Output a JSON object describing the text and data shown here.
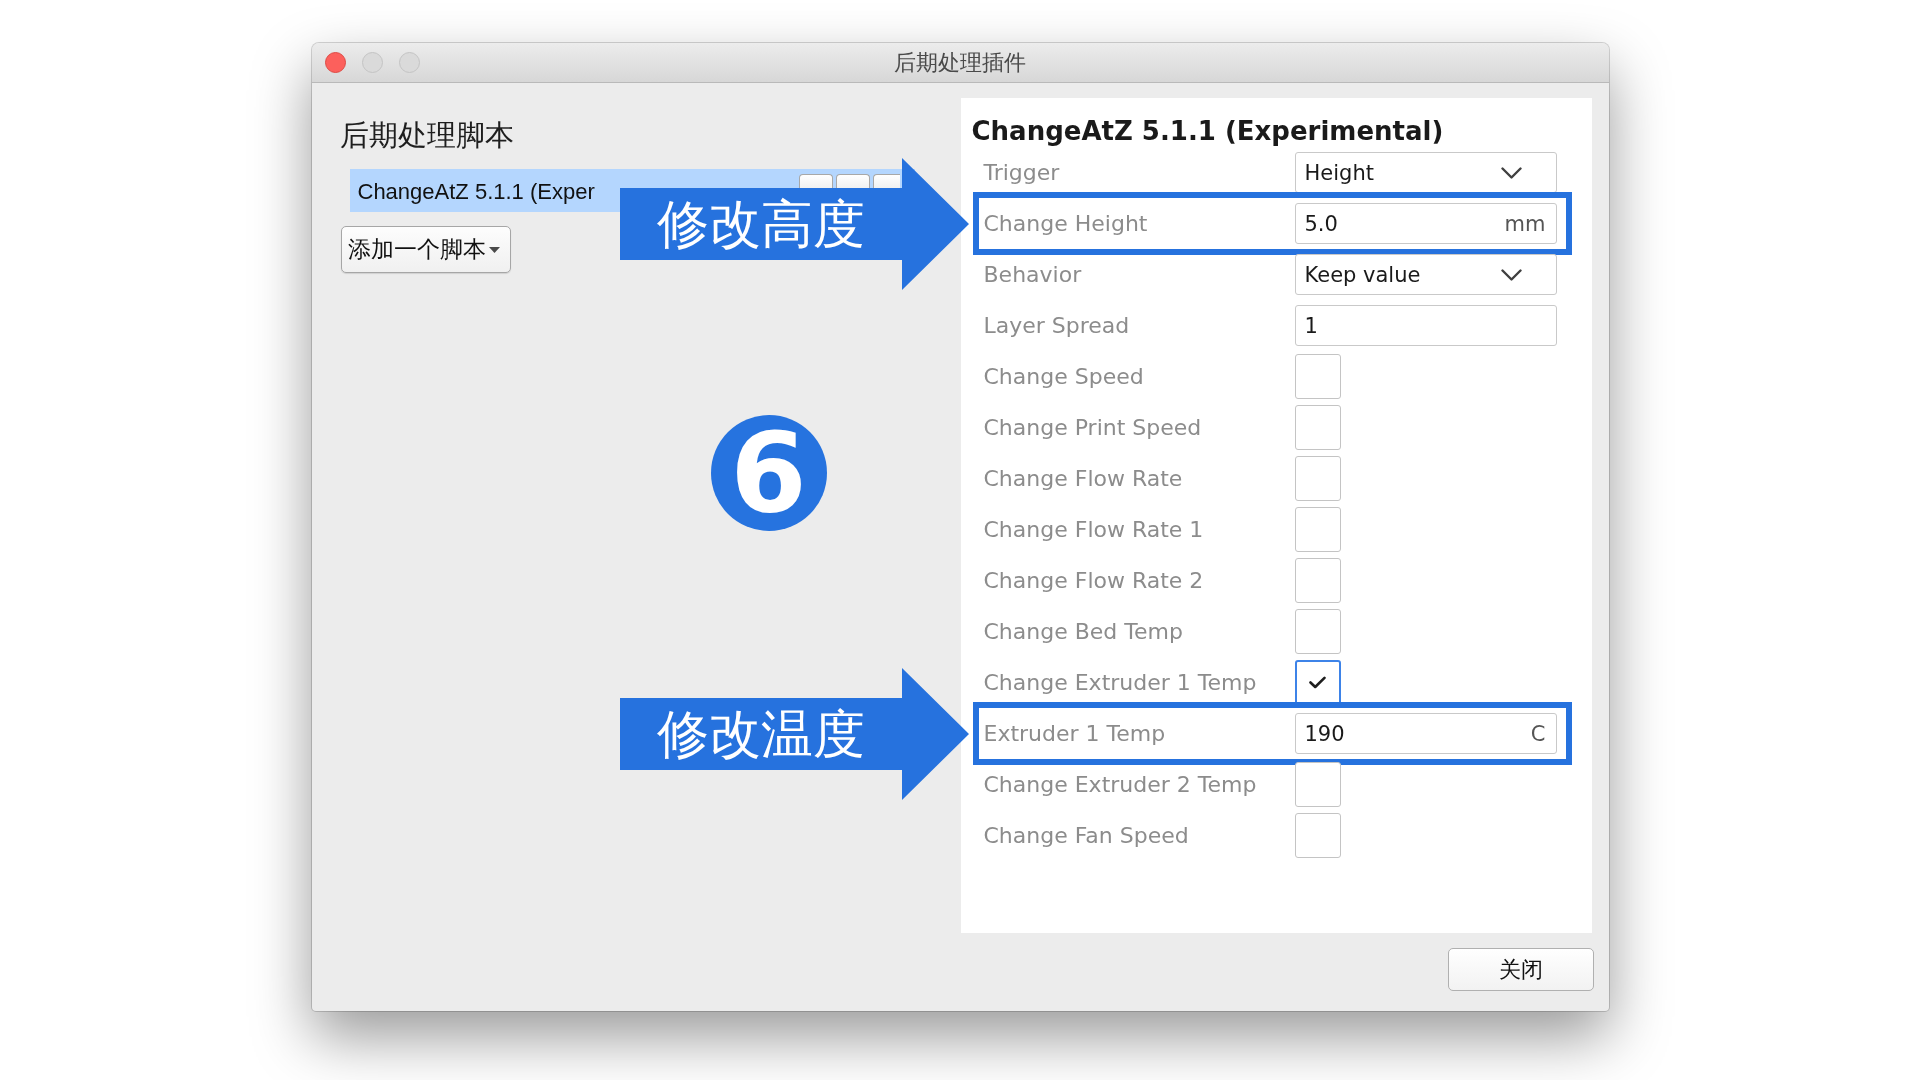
{
  "window": {
    "title": "后期处理插件",
    "controls": [
      {
        "kind": "close",
        "disabled": false
      },
      {
        "kind": "minimize",
        "disabled": true
      },
      {
        "kind": "zoom",
        "disabled": true
      }
    ]
  },
  "scripts_panel": {
    "heading": "后期处理脚本",
    "scripts": [
      {
        "label": "ChangeAtZ 5.1.1 (Exper",
        "selected": true
      }
    ],
    "add_button": {
      "label": "添加一个脚本"
    }
  },
  "step_marker": {
    "number": "6"
  },
  "settings_panel": {
    "heading": "ChangeAtZ 5.1.1 (Experimental)",
    "settings": [
      {
        "kind": "dropdown",
        "label": "Trigger",
        "value": "Height"
      },
      {
        "kind": "number",
        "label": "Change Height",
        "value": "5.0",
        "unit": "mm",
        "callout": "修改高度"
      },
      {
        "kind": "dropdown",
        "label": "Behavior",
        "value": "Keep value"
      },
      {
        "kind": "number",
        "label": "Layer Spread",
        "value": "1"
      },
      {
        "kind": "checkbox",
        "label": "Change Speed",
        "checked": false
      },
      {
        "kind": "checkbox",
        "label": "Change Print Speed",
        "checked": false
      },
      {
        "kind": "checkbox",
        "label": "Change Flow Rate",
        "checked": false
      },
      {
        "kind": "checkbox",
        "label": "Change Flow Rate 1",
        "checked": false
      },
      {
        "kind": "checkbox",
        "label": "Change Flow Rate 2",
        "checked": false
      },
      {
        "kind": "checkbox",
        "label": "Change Bed Temp",
        "checked": false
      },
      {
        "kind": "checkbox",
        "label": "Change Extruder 1 Temp",
        "checked": true
      },
      {
        "kind": "number",
        "label": "Extruder 1 Temp",
        "value": "190",
        "unit": "C",
        "callout": "修改温度"
      },
      {
        "kind": "checkbox",
        "label": "Change Extruder 2 Temp",
        "checked": false
      },
      {
        "kind": "checkbox",
        "label": "Change Fan Speed",
        "checked": false
      }
    ]
  },
  "buttons": [
    "关闭"
  ]
}
